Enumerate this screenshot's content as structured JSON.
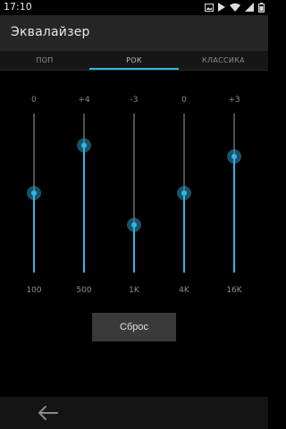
{
  "status_bar": {
    "time": "17:10",
    "icons": [
      "image-icon",
      "play-store-icon",
      "wifi-icon",
      "signal-icon",
      "battery-icon"
    ]
  },
  "app_bar": {
    "title": "Эквалайзер"
  },
  "tabs": [
    {
      "label": "ПОП",
      "active": false
    },
    {
      "label": "РОК",
      "active": true
    },
    {
      "label": "КЛАССИКА",
      "active": false
    }
  ],
  "equalizer": {
    "bands": [
      {
        "gain_label": "0",
        "frequency": "100",
        "level": 0.5
      },
      {
        "gain_label": "+4",
        "frequency": "500",
        "level": 0.8
      },
      {
        "gain_label": "-3",
        "frequency": "1K",
        "level": 0.3
      },
      {
        "gain_label": "0",
        "frequency": "4K",
        "level": 0.5
      },
      {
        "gain_label": "+3",
        "frequency": "16K",
        "level": 0.73
      }
    ]
  },
  "reset_button": {
    "label": "Сброс"
  },
  "colors": {
    "accent": "#33b5e5",
    "track": "#4f4f4f",
    "app_bar": "#262626"
  }
}
